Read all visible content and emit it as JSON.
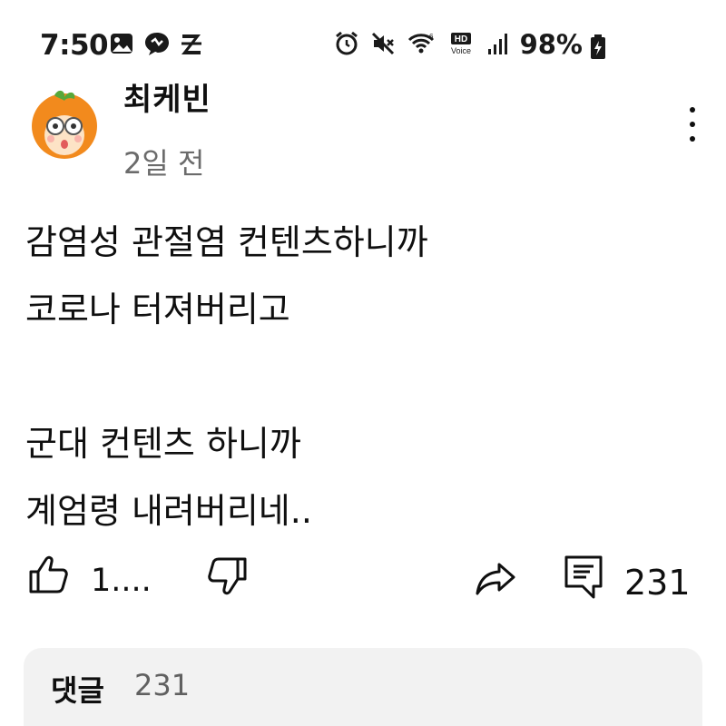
{
  "status_bar": {
    "time": "7:50",
    "battery": "98%",
    "left_icons": [
      "gallery-icon",
      "chat-bubble-icon",
      "z-icon"
    ],
    "right_icons": [
      "alarm-icon",
      "mute-icon",
      "wifi-icon",
      "hd-voice-icon",
      "signal-icon",
      "battery-icon"
    ],
    "hd_voice_top": "HD",
    "hd_voice_bottom": "Voice"
  },
  "post": {
    "channel_name": "최케빈",
    "time_ago": "2일 전",
    "lines": [
      "감염성 관절염 컨텐츠하니까",
      "코로나 터져버리고",
      "",
      "군대 컨텐츠 하니까",
      "계엄령 내려버리네.."
    ]
  },
  "actions": {
    "like_count": "1....",
    "comment_count": "231"
  },
  "comments": {
    "title": "댓글",
    "count": "231"
  },
  "colors": {
    "text": "#0f0f0f",
    "secondary_text": "#6b6b6b",
    "card_bg": "#f2f2f2",
    "avatar_orange": "#f28a1d",
    "leaf_green": "#58a83a"
  }
}
